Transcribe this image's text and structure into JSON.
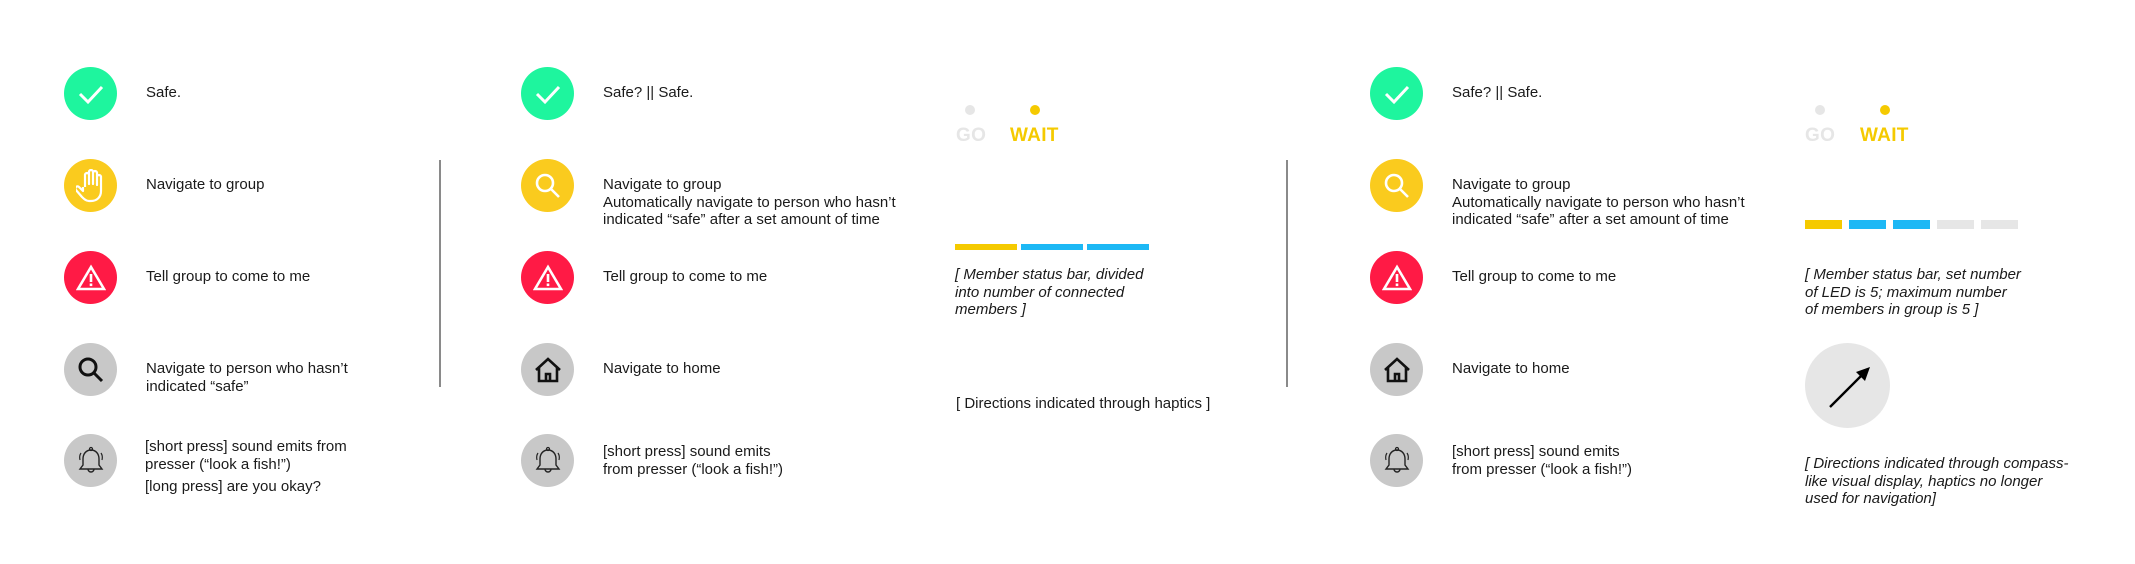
{
  "colors": {
    "green": "#1EF59E",
    "yellow": "#FACB1E",
    "red": "#FF1A45",
    "gray": "#C8C8C8",
    "light_gray": "#E6E6E6",
    "led_yellow": "#F5CA00",
    "led_blue": "#1DB8F5",
    "divider": "#8A8A8A"
  },
  "columns": [
    {
      "rows": [
        {
          "icon": "check-icon",
          "color": "green",
          "lines": [
            "Safe."
          ]
        },
        {
          "icon": "hand-icon",
          "color": "yellow",
          "lines": [
            "Navigate to group"
          ]
        },
        {
          "icon": "warning-icon",
          "color": "red",
          "lines": [
            "Tell group to come to me"
          ]
        },
        {
          "icon": "search-icon",
          "color": "gray",
          "lines": [
            "Navigate to person who hasn’t",
            "indicated “safe”"
          ]
        },
        {
          "icon": "bell-icon",
          "color": "gray",
          "lines": [
            "[short press] sound emits from",
            "presser (“look a fish!”)"
          ],
          "extra": "[long press] are you okay?"
        }
      ]
    },
    {
      "rows": [
        {
          "icon": "check-icon",
          "color": "green",
          "lines": [
            "Safe? || Safe."
          ]
        },
        {
          "icon": "search-icon",
          "color": "yellow",
          "lines": [
            "Navigate to group",
            "Automatically navigate to person who hasn’t",
            "indicated “safe” after a set amount of time"
          ]
        },
        {
          "icon": "warning-icon",
          "color": "red",
          "lines": [
            "Tell group to come to me"
          ]
        },
        {
          "icon": "home-icon",
          "color": "gray",
          "lines": [
            "Navigate to home"
          ]
        },
        {
          "icon": "bell-icon",
          "color": "gray",
          "lines": [
            "[short press] sound emits",
            "from presser (“look a fish!”)"
          ]
        }
      ],
      "display": {
        "led_labels": [
          "GO",
          "WAIT"
        ],
        "active_led": "WAIT",
        "status_bar": {
          "segments": [
            "yellow",
            "blue",
            "blue"
          ]
        },
        "status_note": [
          "[ Member status bar, divided",
          "into number of connected",
          "members ]"
        ],
        "direction_note": "[ Directions indicated through haptics ]"
      }
    },
    {
      "rows": [
        {
          "icon": "check-icon",
          "color": "green",
          "lines": [
            "Safe? || Safe."
          ]
        },
        {
          "icon": "search-icon",
          "color": "yellow",
          "lines": [
            "Navigate to group",
            "Automatically navigate to person who hasn’t",
            "indicated “safe” after a set amount of time"
          ]
        },
        {
          "icon": "warning-icon",
          "color": "red",
          "lines": [
            "Tell group to come to me"
          ]
        },
        {
          "icon": "home-icon",
          "color": "gray",
          "lines": [
            "Navigate to home"
          ]
        },
        {
          "icon": "bell-icon",
          "color": "gray",
          "lines": [
            "[short press] sound emits",
            "from presser (“look a fish!”)"
          ]
        }
      ],
      "display": {
        "led_labels": [
          "GO",
          "WAIT"
        ],
        "active_led": "WAIT",
        "status_bar": {
          "segments": [
            "yellow",
            "blue",
            "blue",
            "off",
            "off"
          ],
          "led_count": 5,
          "max_members": 5
        },
        "status_note": [
          "[ Member status bar, set number",
          "of LED is 5; maximum number",
          "of members in group is 5 ]"
        ],
        "compass": {
          "direction": "north-east"
        },
        "direction_note": [
          "[ Directions indicated through compass-",
          "like visual display, haptics no longer",
          "used for navigation]"
        ]
      }
    }
  ]
}
